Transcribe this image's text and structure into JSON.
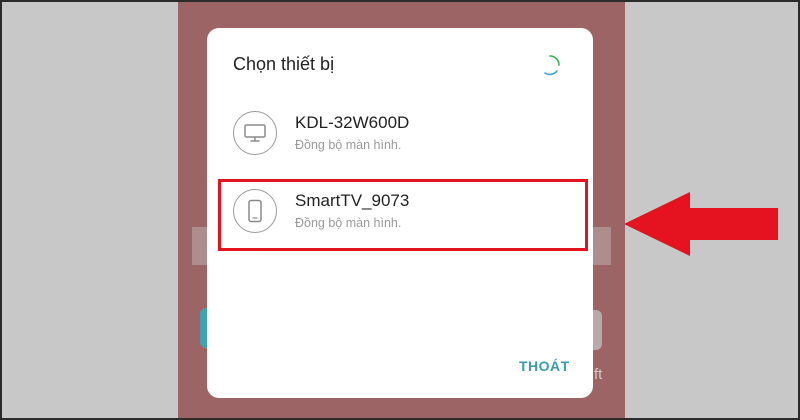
{
  "dialog": {
    "title": "Chọn thiết bị",
    "exit_label": "THOÁT",
    "devices": [
      {
        "name": "KDL-32W600D",
        "status": "Đồng bộ màn hình.",
        "icon": "tv-icon"
      },
      {
        "name": "SmartTV_9073",
        "status": "Đồng bộ màn hình.",
        "icon": "phone-icon"
      }
    ]
  },
  "background": {
    "partial_text": "ft"
  },
  "colors": {
    "highlight": "#e4131f",
    "arrow": "#e4131f",
    "accent": "#3a9ab0",
    "phone_background": "#9c6464"
  }
}
